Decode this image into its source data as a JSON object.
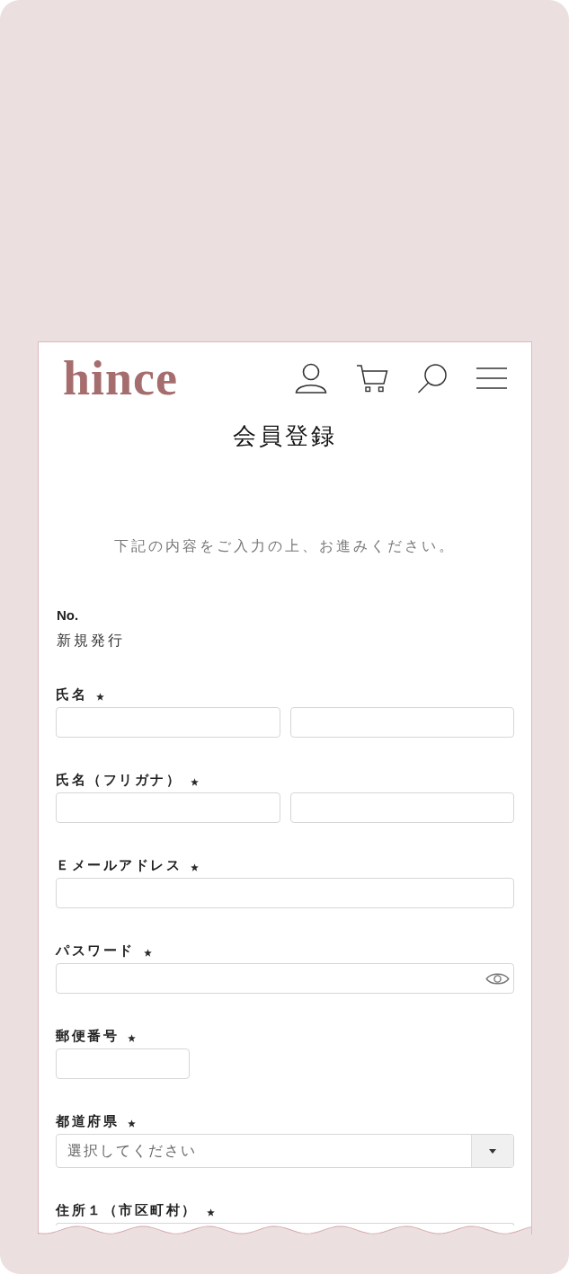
{
  "header": {
    "logo": "hince"
  },
  "page_title": "会員登録",
  "intro": "下記の内容をご入力の上、お進みください。",
  "member_number": {
    "label": "No.",
    "value": "新規発行"
  },
  "fields": [
    {
      "kind": "pair",
      "label": "氏名",
      "required": true
    },
    {
      "kind": "pair",
      "label": "氏名（フリガナ）",
      "required": true
    },
    {
      "kind": "text",
      "label": "Ｅメールアドレス",
      "required": true
    },
    {
      "kind": "password",
      "label": "パスワード",
      "required": true
    },
    {
      "kind": "short",
      "label": "郵便番号",
      "required": true
    },
    {
      "kind": "select",
      "label": "都道府県",
      "required": true,
      "placeholder": "選択してください"
    },
    {
      "kind": "text",
      "label": "住所１（市区町村）",
      "required": true
    }
  ]
}
